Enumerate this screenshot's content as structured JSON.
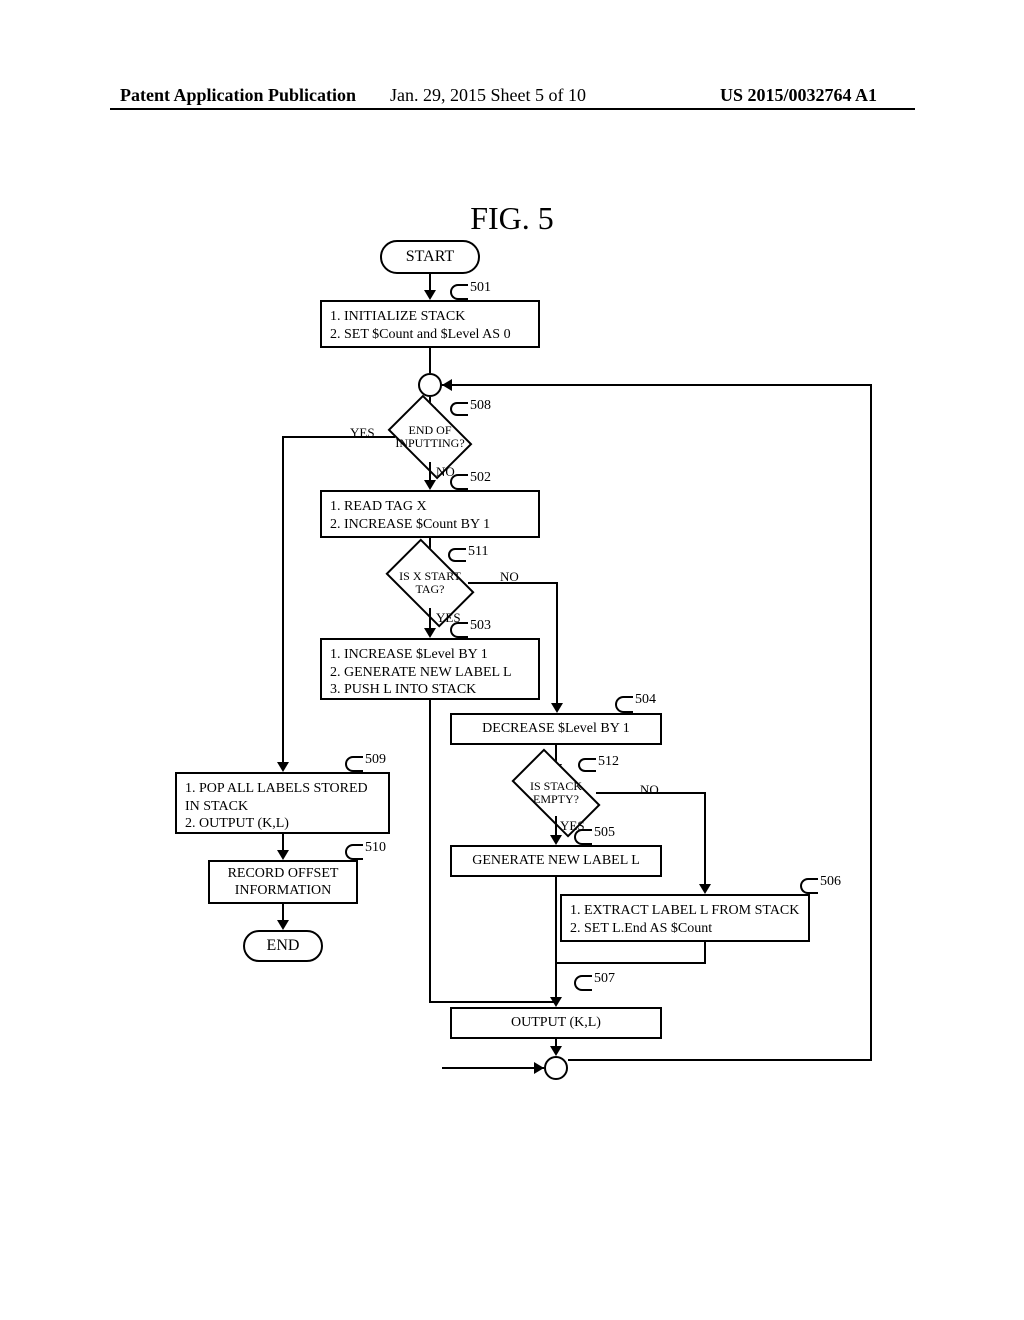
{
  "header": {
    "left": "Patent Application Publication",
    "center": "Jan. 29, 2015  Sheet 5 of 10",
    "right": "US 2015/0032764 A1"
  },
  "figure_title": "FIG. 5",
  "nodes": {
    "start": "START",
    "end": "END",
    "b501": "1. INITIALIZE STACK\n2. SET $Count and $Level AS 0",
    "b502": "1. READ TAG X\n2. INCREASE $Count BY 1",
    "b503": "1. INCREASE $Level BY 1\n2. GENERATE NEW LABEL L\n3. PUSH L INTO STACK",
    "b504": "DECREASE $Level BY 1",
    "b505": "GENERATE NEW LABEL L",
    "b506": "1. EXTRACT LABEL L FROM STACK\n2. SET L.End AS $Count",
    "b507": "OUTPUT (K,L)",
    "b509": "1. POP ALL LABELS STORED IN STACK\n2. OUTPUT (K,L)",
    "b510": "RECORD OFFSET INFORMATION",
    "d508": "END OF INPUTTING?",
    "d511": "IS X START TAG?",
    "d512": "IS STACK EMPTY?"
  },
  "refs": {
    "r501": "501",
    "r502": "502",
    "r503": "503",
    "r504": "504",
    "r505": "505",
    "r506": "506",
    "r507": "507",
    "r508": "508",
    "r509": "509",
    "r510": "510",
    "r511": "511",
    "r512": "512"
  },
  "labels": {
    "yes": "YES",
    "no": "NO"
  }
}
